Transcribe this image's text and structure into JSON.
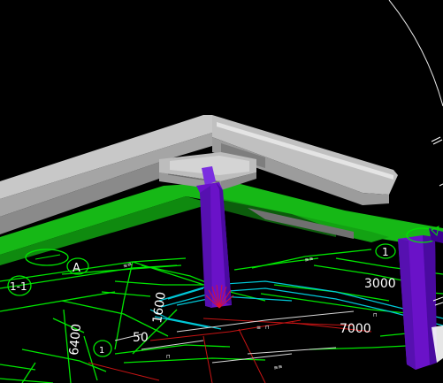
{
  "viewport": {
    "background": "#000000",
    "colors": {
      "beam_top": "#c8c8c8",
      "beam_side": "#a5a5a5",
      "beam_dark": "#7e7e7e",
      "slab_green": "#16b816",
      "grid_green": "#00e600",
      "column_purple": "#6a12c8",
      "column_purple_dark": "#4a0aa0",
      "axis_cyan": "#00c8d8",
      "dim_red": "#c81414",
      "label_white": "#ffffff"
    }
  },
  "labels": {
    "axis_a": "A",
    "axis_1": "1",
    "section": "1-1",
    "dim_1600": "1600",
    "dim_50": "50",
    "dim_6400": "6400",
    "dim_3000": "3000",
    "dim_7000": "7000",
    "small_1": "1"
  }
}
